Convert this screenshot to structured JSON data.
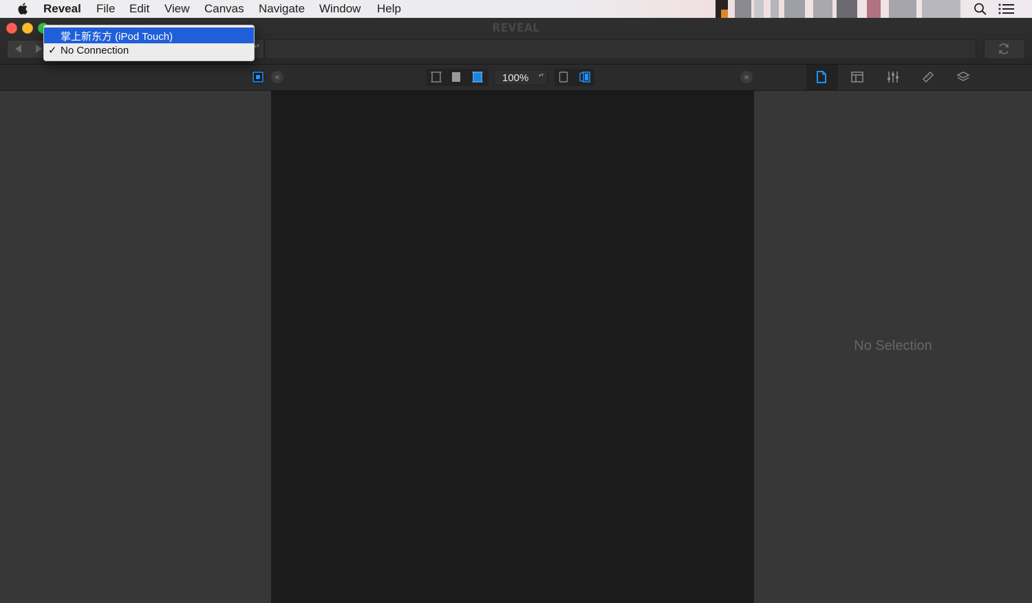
{
  "menubar": {
    "app_name": "Reveal",
    "items": [
      "File",
      "Edit",
      "View",
      "Canvas",
      "Navigate",
      "Window",
      "Help"
    ]
  },
  "window": {
    "title": "REVEAL"
  },
  "connection_menu": {
    "items": [
      {
        "label": "掌上新东方 (iPod Touch)",
        "highlighted": true,
        "checked": false
      },
      {
        "label": "No Connection",
        "highlighted": false,
        "checked": true,
        "check_mark": "✓"
      }
    ]
  },
  "toolbar": {
    "zoom_value": "100%",
    "collapse_left_glyph": "«",
    "collapse_right_glyph": "»",
    "popup_arrows_glyph": "▴▾"
  },
  "inspector": {
    "empty_text": "No Selection",
    "tabs": [
      "file-inspector-icon",
      "layout-inspector-icon",
      "attributes-inspector-icon",
      "ruler-inspector-icon",
      "layers-inspector-icon"
    ],
    "active_tab": "file-inspector-icon"
  },
  "colors": {
    "accent": "#1a93ff",
    "menu_highlight": "#1f5fd9",
    "pane_bg": "#373737",
    "canvas_bg": "#1b1b1b"
  },
  "icons": {
    "apple": "apple-icon",
    "search": "search-icon",
    "notifications": "notification-list-icon",
    "reload": "reload-icon"
  }
}
